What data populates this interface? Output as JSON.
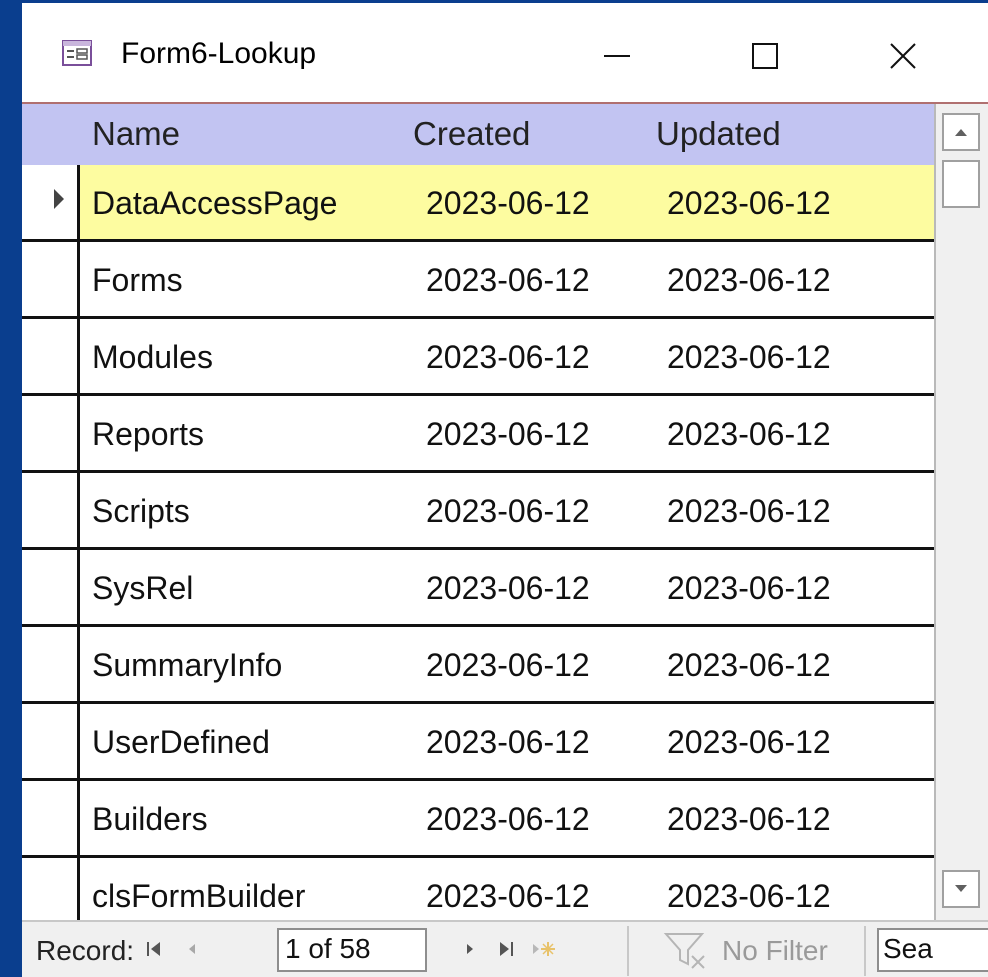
{
  "window": {
    "title": "Form6-Lookup",
    "icon": "form-icon"
  },
  "columns": {
    "name": "Name",
    "created": "Created",
    "updated": "Updated"
  },
  "rows": [
    {
      "name": "DataAccessPage",
      "created": "2023-06-12",
      "updated": "2023-06-12"
    },
    {
      "name": "Forms",
      "created": "2023-06-12",
      "updated": "2023-06-12"
    },
    {
      "name": "Modules",
      "created": "2023-06-12",
      "updated": "2023-06-12"
    },
    {
      "name": "Reports",
      "created": "2023-06-12",
      "updated": "2023-06-12"
    },
    {
      "name": "Scripts",
      "created": "2023-06-12",
      "updated": "2023-06-12"
    },
    {
      "name": "SysRel",
      "created": "2023-06-12",
      "updated": "2023-06-12"
    },
    {
      "name": "SummaryInfo",
      "created": "2023-06-12",
      "updated": "2023-06-12"
    },
    {
      "name": "UserDefined",
      "created": "2023-06-12",
      "updated": "2023-06-12"
    },
    {
      "name": "Builders",
      "created": "2023-06-12",
      "updated": "2023-06-12"
    },
    {
      "name": "clsFormBuilder",
      "created": "2023-06-12",
      "updated": "2023-06-12"
    }
  ],
  "navigation": {
    "record_label": "Record:",
    "record_position": "1 of 58",
    "filter_label": "No Filter",
    "search_value": "Sea"
  },
  "colors": {
    "header_bg": "#c2c4f2",
    "current_row_bg": "#fdfca0",
    "desktop_bg": "#0a3e8e"
  }
}
